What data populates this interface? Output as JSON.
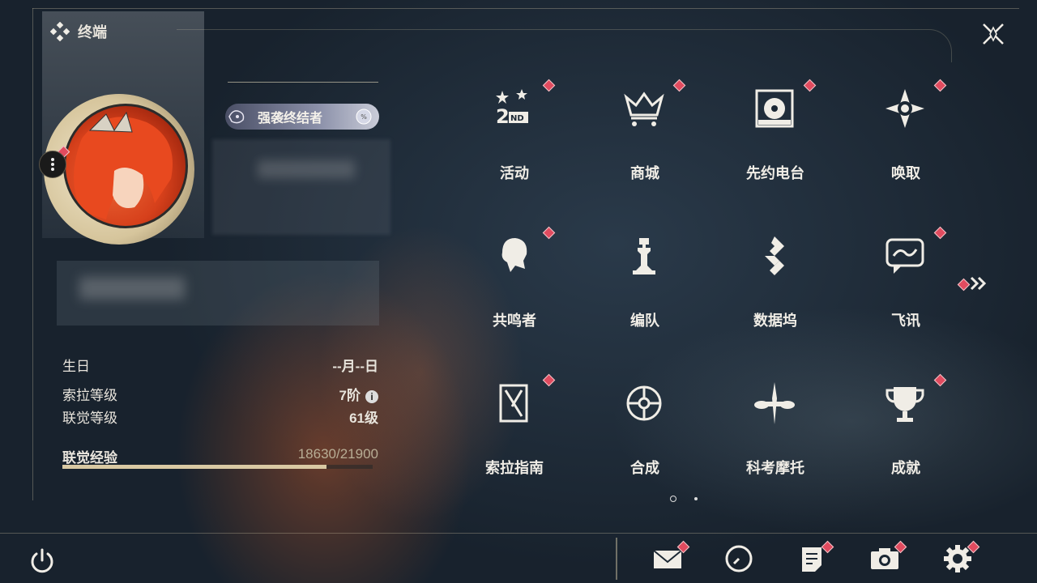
{
  "header": {
    "title": "终端"
  },
  "profile": {
    "badge_title": "强袭终结者",
    "info": [
      {
        "label": "生日",
        "value": "--月--日"
      },
      {
        "label": "索拉等级",
        "value": "7阶"
      },
      {
        "label": "联觉等级",
        "value": "61级"
      }
    ],
    "exp": {
      "label": "联觉经验",
      "value": "18630/21900",
      "current": 18630,
      "max": 21900
    }
  },
  "menu": [
    {
      "label": "活动",
      "icon": "event-2nd-anniversary-icon",
      "notify": true
    },
    {
      "label": "商城",
      "icon": "shop-crown-icon",
      "notify": true
    },
    {
      "label": "先约电台",
      "icon": "radio-record-icon",
      "notify": true
    },
    {
      "label": "唤取",
      "icon": "compass-star-icon",
      "notify": true
    },
    {
      "label": "共鸣者",
      "icon": "character-silhouette-icon",
      "notify": true
    },
    {
      "label": "编队",
      "icon": "chess-team-icon",
      "notify": false
    },
    {
      "label": "数据坞",
      "icon": "data-dock-icon",
      "notify": false
    },
    {
      "label": "飞讯",
      "icon": "message-bubble-icon",
      "notify": true
    },
    {
      "label": "索拉指南",
      "icon": "guide-book-icon",
      "notify": true
    },
    {
      "label": "合成",
      "icon": "synthesis-icon",
      "notify": false
    },
    {
      "label": "科考摩托",
      "icon": "motorcycle-icon",
      "notify": false
    },
    {
      "label": "成就",
      "icon": "trophy-icon",
      "notify": true
    }
  ],
  "bottom_bar": [
    {
      "icon": "mail-icon",
      "notify": true
    },
    {
      "icon": "clock-icon",
      "notify": false
    },
    {
      "icon": "notice-icon",
      "notify": true
    },
    {
      "icon": "camera-icon",
      "notify": true
    },
    {
      "icon": "settings-gear-icon",
      "notify": true
    }
  ],
  "pagination": {
    "current": 1,
    "total": 2
  },
  "colors": {
    "accent": "#d9c9a3",
    "notify": "#e14b5f",
    "text": "#f0ede6"
  }
}
